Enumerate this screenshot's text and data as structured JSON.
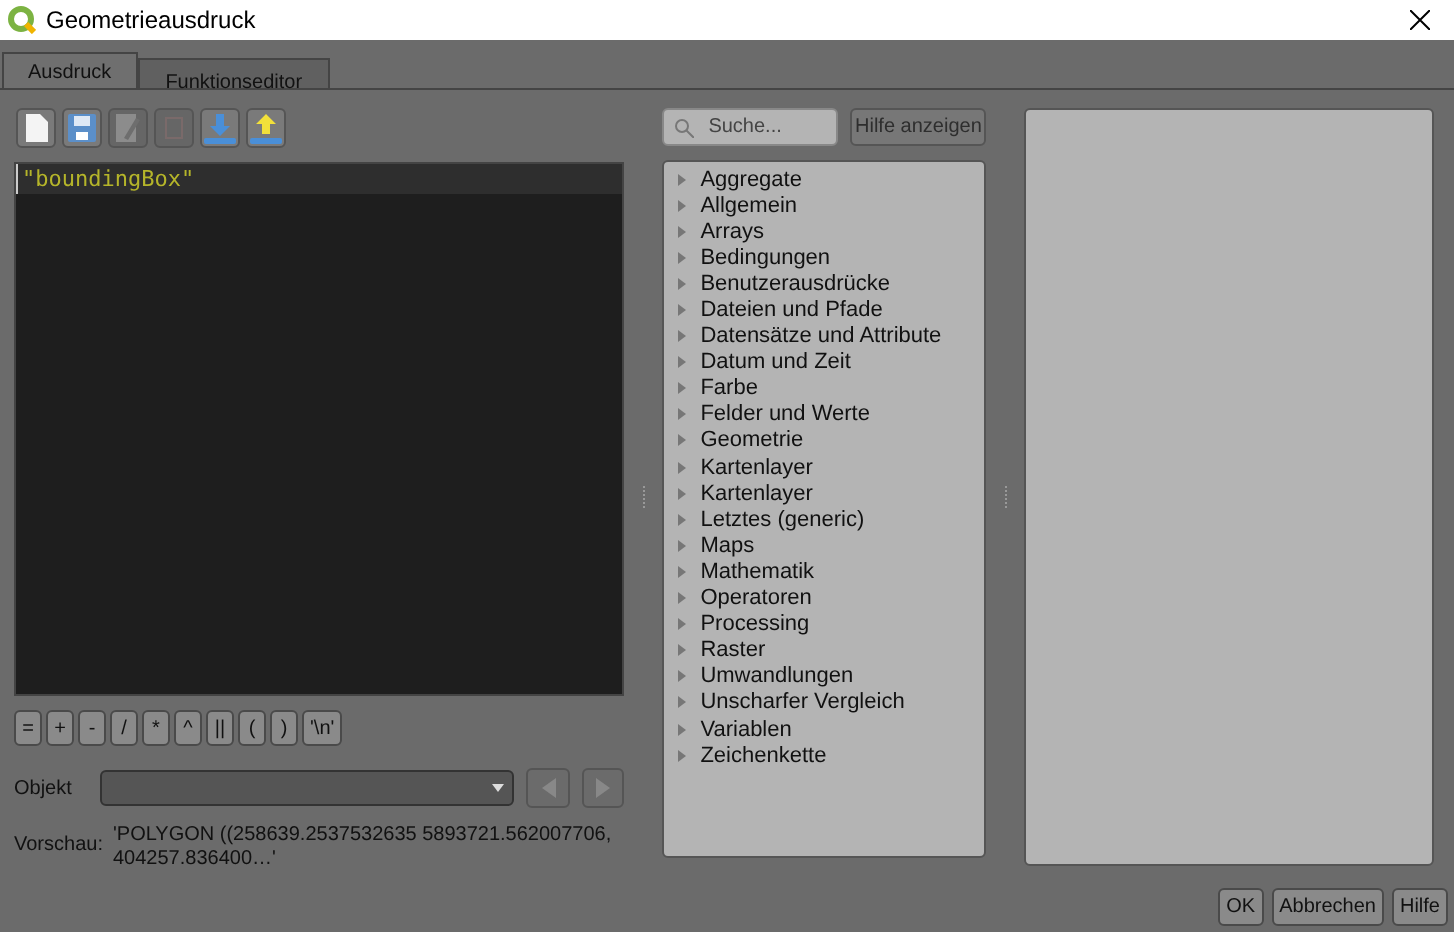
{
  "window": {
    "title": "Geometrieausdruck"
  },
  "tabs": [
    {
      "label": "Ausdruck",
      "selected": true
    },
    {
      "label": "Funktionseditor",
      "selected": false
    }
  ],
  "toolbar": [
    {
      "kind": "new",
      "disabled": false
    },
    {
      "kind": "save",
      "disabled": false
    },
    {
      "kind": "edit",
      "disabled": true
    },
    {
      "kind": "delete",
      "disabled": true
    },
    {
      "kind": "import",
      "disabled": false
    },
    {
      "kind": "export",
      "disabled": false
    }
  ],
  "editor": {
    "lines": [
      "\"boundingBox\""
    ]
  },
  "operators": [
    "=",
    "+",
    "-",
    "/",
    "*",
    "^",
    "||",
    "(",
    ")",
    "'\\n'"
  ],
  "object": {
    "label": "Objekt"
  },
  "preview": {
    "label": "Vorschau:",
    "value": "'POLYGON ((258639.2537532635 5893721.562007706, 404257.836400…'"
  },
  "search": {
    "placeholder": "Suche..."
  },
  "help_button": {
    "label": "Hilfe anzeigen",
    "disabled": true
  },
  "groups": [
    {
      "label": "Aggregate"
    },
    {
      "label": "Allgemein"
    },
    {
      "label": "Arrays"
    },
    {
      "label": "Bedingungen"
    },
    {
      "label": "Benutzerausdrücke"
    },
    {
      "label": "Dateien und Pfade"
    },
    {
      "label": "Datensätze und Attribute"
    },
    {
      "label": "Datum und Zeit"
    },
    {
      "label": "Farbe"
    },
    {
      "label": "Felder und Werte"
    },
    {
      "label": "Geometrie"
    },
    {
      "label": "Kartenlayer"
    },
    {
      "label": "Kartenlayer"
    },
    {
      "label": "Letztes (generic)"
    },
    {
      "label": "Maps"
    },
    {
      "label": "Mathematik"
    },
    {
      "label": "Operatoren"
    },
    {
      "label": "Processing"
    },
    {
      "label": "Raster"
    },
    {
      "label": "Umwandlungen"
    },
    {
      "label": "Unscharfer Vergleich"
    },
    {
      "label": "Variablen"
    },
    {
      "label": "Zeichenkette"
    }
  ],
  "buttons": [
    "OK",
    "Abbrechen",
    "Hilfe"
  ]
}
